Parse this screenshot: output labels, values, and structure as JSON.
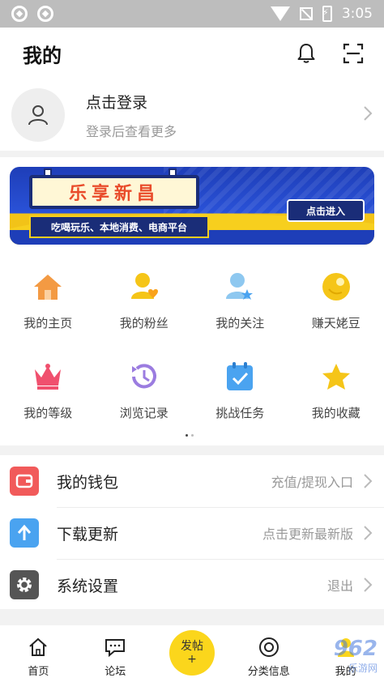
{
  "status_bar": {
    "time": "3:05"
  },
  "header": {
    "title": "我的"
  },
  "login": {
    "title": "点击登录",
    "subtitle": "登录后查看更多"
  },
  "banner": {
    "title": "乐享新昌",
    "subtitle": "吃喝玩乐、本地消费、电商平台",
    "button": "点击进入"
  },
  "grid": [
    {
      "label": "我的主页",
      "icon": "home-icon",
      "color": "#f39a43"
    },
    {
      "label": "我的粉丝",
      "icon": "fans-icon",
      "color": "#f5c518"
    },
    {
      "label": "我的关注",
      "icon": "follow-icon",
      "color": "#6ab4e8"
    },
    {
      "label": "赚天姥豆",
      "icon": "bean-icon",
      "color": "#f5c518"
    },
    {
      "label": "我的等级",
      "icon": "crown-icon",
      "color": "#f0506e"
    },
    {
      "label": "浏览记录",
      "icon": "history-icon",
      "color": "#9b7ce0"
    },
    {
      "label": "挑战任务",
      "icon": "task-icon",
      "color": "#4aa3f0"
    },
    {
      "label": "我的收藏",
      "icon": "star-icon",
      "color": "#f5c518"
    }
  ],
  "list": [
    {
      "label": "我的钱包",
      "value": "充值/提现入口",
      "icon": "wallet-icon",
      "color": "#f15a5a"
    },
    {
      "label": "下载更新",
      "value": "点击更新最新版",
      "icon": "upload-icon",
      "color": "#4aa3f0"
    },
    {
      "label": "系统设置",
      "value": "退出",
      "icon": "gear-icon",
      "color": "#555555"
    }
  ],
  "bottom_nav": {
    "home": "首页",
    "forum": "论坛",
    "post_line1": "发帖",
    "post_line2": "+",
    "category": "分类信息",
    "mine": "我的"
  },
  "watermark": {
    "main": "962",
    "sub": "乐游网"
  }
}
